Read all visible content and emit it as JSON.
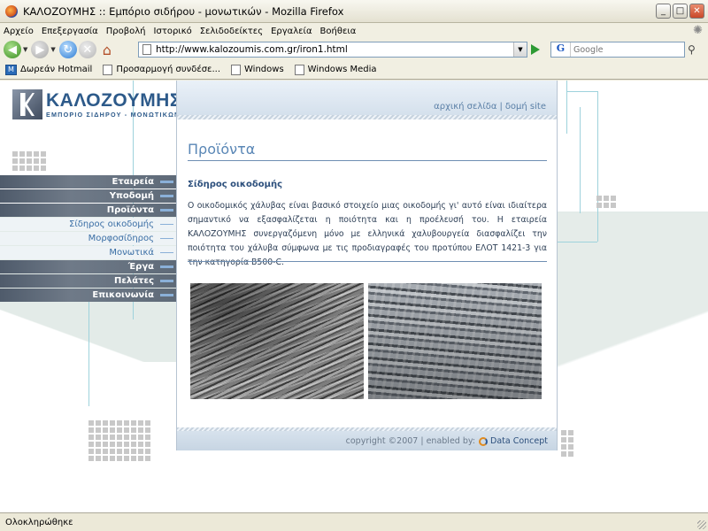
{
  "window": {
    "title": "ΚΑΛΟΖΟΥΜΗΣ :: Εμπόριο σιδήρου - μονωτικών - Mozilla Firefox",
    "minimize": "_",
    "maximize": "□",
    "close": "✕"
  },
  "menubar": {
    "items": [
      "Αρχείο",
      "Επεξεργασία",
      "Προβολή",
      "Ιστορικό",
      "Σελιδοδείκτες",
      "Εργαλεία",
      "Βοήθεια"
    ]
  },
  "navbar": {
    "url": "http://www.kalozoumis.com.gr/iron1.html",
    "search_placeholder": "Google",
    "search_engine_letter": "G"
  },
  "bookmarks": {
    "items": [
      "Δωρεάν Hotmail",
      "Προσαρμογή συνδέσε...",
      "Windows",
      "Windows Media"
    ]
  },
  "site": {
    "logo_name": "ΚΑΛΟΖΟΥΜΗΣ",
    "logo_tagline": "ΕΜΠΟΡΙΟ ΣΙΔΗΡΟΥ - ΜΟΝΩΤΙΚΩΝ",
    "menu": [
      {
        "label": "Εταιρεία",
        "kind": "main"
      },
      {
        "label": "Υποδομή",
        "kind": "main"
      },
      {
        "label": "Προϊόντα",
        "kind": "main"
      },
      {
        "label": "Σίδηρος οικοδομής",
        "kind": "sub"
      },
      {
        "label": "Μορφοσίδηρος",
        "kind": "sub"
      },
      {
        "label": "Μονωτικά",
        "kind": "sub"
      },
      {
        "label": "Έργα",
        "kind": "main"
      },
      {
        "label": "Πελάτες",
        "kind": "main"
      },
      {
        "label": "Επικοινωνία",
        "kind": "main"
      }
    ],
    "toplinks": {
      "home": "αρχική σελίδα",
      "separator": "|",
      "sitemap": "δομή site"
    },
    "page_title": "Προϊόντα",
    "subheading": "Σίδηρος οικοδομής",
    "paragraph": "Ο οικοδομικός χάλυβας είναι βασικό στοιχείο μιας οικοδομής γι' αυτό είναι ιδιαίτερα σημαντικό να εξασφαλίζεται η ποιότητα και η προέλευσή του. Η εταιρεία ΚΑΛΟΖΟΥΜΗΣ συνεργαζόμενη μόνο με ελληνικά χαλυβουργεία διασφαλίζει την ποιότητα του χάλυβα σύμφωνα με τις προδιαγραφές του προτύπου ΕΛΟΤ 1421-3 για την κατηγορία B500-C.",
    "footer_copyright": "copyright ©2007 | enabled by:",
    "footer_brand": "Data Concept"
  },
  "statusbar": {
    "text": "Ολοκληρώθηκε"
  }
}
